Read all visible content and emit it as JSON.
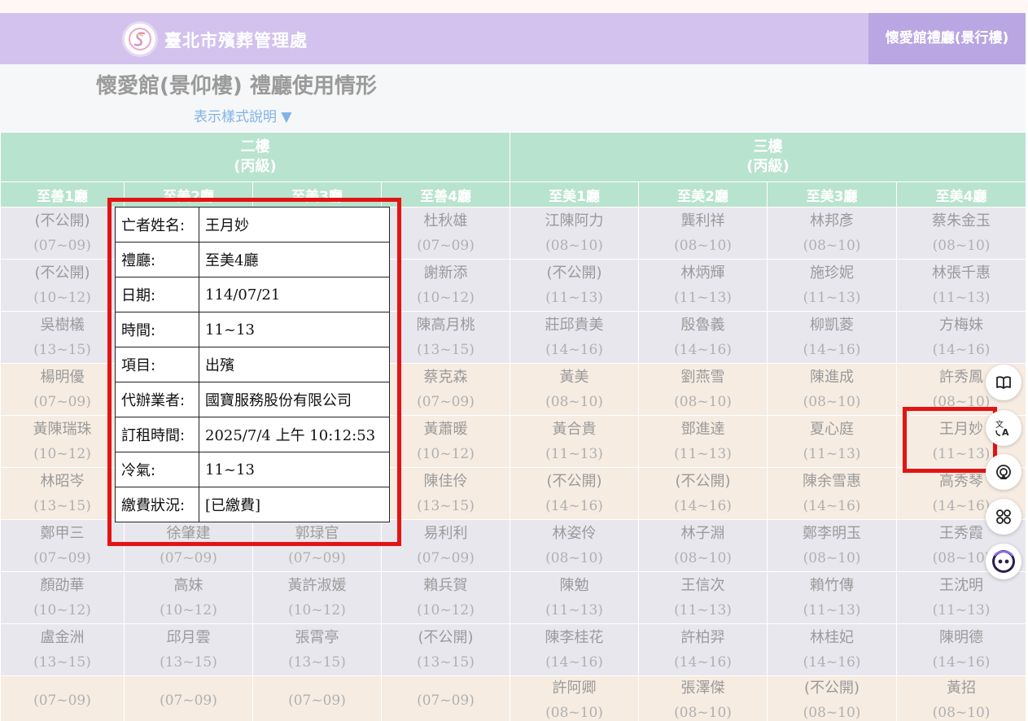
{
  "header": {
    "org_name": "臺北市殯葬管理處",
    "hall_link": "懷愛館禮廳(景行樓)",
    "logo_icon": "logo-icon"
  },
  "page": {
    "title": "懷愛館(景仰樓) 禮廳使用情形",
    "legend_toggle": "表示樣式說明 ▼"
  },
  "floors": [
    {
      "name": "二樓",
      "grade": "(丙級)"
    },
    {
      "name": "三樓",
      "grade": "(丙級)"
    }
  ],
  "halls": [
    "至善1廳",
    "至美2廳",
    "至美3廳",
    "至善4廳",
    "至美1廳",
    "至美2廳",
    "至美3廳",
    "至美4廳"
  ],
  "rows": [
    {
      "tone": "g",
      "cells": [
        [
          "(不公開)",
          "(07~09)"
        ],
        [
          "",
          ""
        ],
        [
          "",
          ""
        ],
        [
          "杜秋雄",
          "(07~09)"
        ],
        [
          "江陳阿力",
          "(08~10)"
        ],
        [
          "龔利祥",
          "(08~10)"
        ],
        [
          "林邦彥",
          "(08~10)"
        ],
        [
          "蔡朱金玉",
          "(08~10)"
        ]
      ]
    },
    {
      "tone": "g",
      "cells": [
        [
          "(不公開)",
          "(10~12)"
        ],
        [
          "",
          ""
        ],
        [
          "",
          ""
        ],
        [
          "謝新添",
          "(10~12)"
        ],
        [
          "(不公開)",
          "(11~13)"
        ],
        [
          "林炳輝",
          "(11~13)"
        ],
        [
          "施珍妮",
          "(11~13)"
        ],
        [
          "林張千惠",
          "(11~13)"
        ]
      ]
    },
    {
      "tone": "g",
      "cells": [
        [
          "吳樹檥",
          "(13~15)"
        ],
        [
          "",
          ""
        ],
        [
          "",
          ""
        ],
        [
          "陳高月桃",
          "(13~15)"
        ],
        [
          "莊邱貴美",
          "(14~16)"
        ],
        [
          "殷魯義",
          "(14~16)"
        ],
        [
          "柳凱菱",
          "(14~16)"
        ],
        [
          "方梅妹",
          "(14~16)"
        ]
      ]
    },
    {
      "tone": "p",
      "cells": [
        [
          "楊明優",
          "(07~09)"
        ],
        [
          "",
          ""
        ],
        [
          "",
          ""
        ],
        [
          "蔡克森",
          "(07~09)"
        ],
        [
          "黃美",
          "(08~10)"
        ],
        [
          "劉燕雪",
          "(08~10)"
        ],
        [
          "陳進成",
          "(08~10)"
        ],
        [
          "許秀鳳",
          "(08~10)"
        ]
      ]
    },
    {
      "tone": "p",
      "cells": [
        [
          "黃陳瑞珠",
          "(10~12)"
        ],
        [
          "",
          ""
        ],
        [
          "",
          ""
        ],
        [
          "黃蕭暖",
          "(10~12)"
        ],
        [
          "黃合貴",
          "(11~13)"
        ],
        [
          "鄧進達",
          "(11~13)"
        ],
        [
          "夏心庭",
          "(11~13)"
        ],
        [
          "王月妙",
          "(11~13)"
        ]
      ]
    },
    {
      "tone": "p",
      "cells": [
        [
          "林昭岑",
          "(13~15)"
        ],
        [
          "",
          ""
        ],
        [
          "",
          ""
        ],
        [
          "陳佳伶",
          "(13~15)"
        ],
        [
          "(不公開)",
          "(14~16)"
        ],
        [
          "(不公開)",
          "(14~16)"
        ],
        [
          "陳余雪惠",
          "(14~16)"
        ],
        [
          "高秀琴",
          "(14~16)"
        ]
      ]
    },
    {
      "tone": "g",
      "cells": [
        [
          "鄭甲三",
          "(07~09)"
        ],
        [
          "徐肇建",
          "(07~09)"
        ],
        [
          "郭琭官",
          "(07~09)"
        ],
        [
          "易利利",
          "(07~09)"
        ],
        [
          "林姿伶",
          "(08~10)"
        ],
        [
          "林子淵",
          "(08~10)"
        ],
        [
          "鄭李明玉",
          "(08~10)"
        ],
        [
          "王秀霞",
          "(08~10)"
        ]
      ]
    },
    {
      "tone": "g",
      "cells": [
        [
          "顏劭華",
          "(10~12)"
        ],
        [
          "高妹",
          "(10~12)"
        ],
        [
          "黃許淑媛",
          "(10~12)"
        ],
        [
          "賴兵賀",
          "(10~12)"
        ],
        [
          "陳勉",
          "(11~13)"
        ],
        [
          "王信次",
          "(11~13)"
        ],
        [
          "賴竹傳",
          "(11~13)"
        ],
        [
          "王沈明",
          "(11~13)"
        ]
      ]
    },
    {
      "tone": "g",
      "cells": [
        [
          "盧金洲",
          "(13~15)"
        ],
        [
          "邱月雲",
          "(13~15)"
        ],
        [
          "張霄亭",
          "(13~15)"
        ],
        [
          "(不公開)",
          "(13~15)"
        ],
        [
          "陳李桂花",
          "(14~16)"
        ],
        [
          "許柏羿",
          "(14~16)"
        ],
        [
          "林桂妃",
          "(14~16)"
        ],
        [
          "陳明德",
          "(14~16)"
        ]
      ]
    },
    {
      "tone": "p",
      "cells": [
        [
          "",
          "(07~09)"
        ],
        [
          "",
          "(07~09)"
        ],
        [
          "",
          "(07~09)"
        ],
        [
          "",
          "(07~09)"
        ],
        [
          "許阿卿",
          "(08~10)"
        ],
        [
          "張澤傑",
          "(08~10)"
        ],
        [
          "(不公開)",
          "(08~10)"
        ],
        [
          "黃招",
          "(08~10)"
        ]
      ]
    }
  ],
  "popup": {
    "rows": [
      {
        "key": "亡者姓名:",
        "value": "王月妙"
      },
      {
        "key": "禮廳:",
        "value": "至美4廳"
      },
      {
        "key": "日期:",
        "value": "114/07/21"
      },
      {
        "key": "時間:",
        "value": "11~13"
      },
      {
        "key": "項目:",
        "value": "出殯"
      },
      {
        "key": "代辦業者:",
        "value": "國寶服務股份有限公司"
      },
      {
        "key": "訂租時間:",
        "value": "2025/7/4 上午 10:12:53"
      },
      {
        "key": "冷氣:",
        "value": "11~13"
      },
      {
        "key": "繳費狀況:",
        "value": "[已繳費]"
      }
    ]
  },
  "floating_tools": [
    "book-icon",
    "translate-icon",
    "cast-icon",
    "apps-icon",
    "assistant-icon"
  ],
  "colors": {
    "header_bg": "#d3c2ee",
    "hall_link_bg": "#b9a6e2",
    "table_head_bg": "#b8e3cf",
    "cell_gray": "#e9e7ee",
    "cell_peach": "#f6ece2",
    "highlight": "#e31414",
    "legend_link": "#7fb3e6"
  }
}
